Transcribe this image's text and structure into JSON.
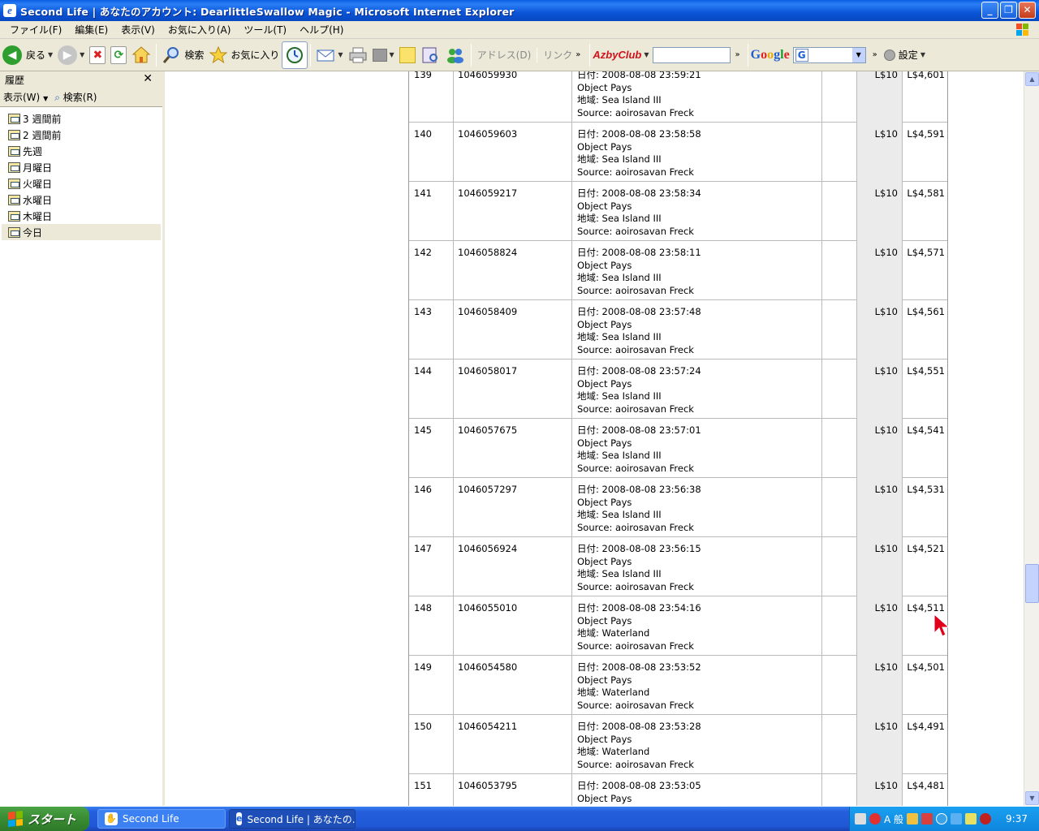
{
  "window": {
    "title": "Second Life | あなたのアカウント: DearlittleSwallow Magic - Microsoft Internet Explorer",
    "minimize": "_",
    "restore": "❐",
    "close": "✕"
  },
  "menu": [
    "ファイル(F)",
    "編集(E)",
    "表示(V)",
    "お気に入り(A)",
    "ツール(T)",
    "ヘルプ(H)"
  ],
  "toolbar": {
    "back_label": "戻る",
    "search_label": "検索",
    "favorites_label": "お気に入り",
    "address_label": "アドレス(D)",
    "links_label": "リンク",
    "azby_label": "AzbyClub",
    "google_label_g": "G",
    "google_label_rest": "oogle",
    "settings_label": "設定"
  },
  "history": {
    "title": "履歴",
    "view_label": "表示(W)",
    "search_label": "検索(R)",
    "items": [
      "3 週間前",
      "2 週間前",
      "先週",
      "月曜日",
      "火曜日",
      "水曜日",
      "木曜日",
      "今日"
    ],
    "selected": "今日"
  },
  "transactions": {
    "date_prefix": "日付: ",
    "region_prefix": "地域: ",
    "source_prefix": "Source: ",
    "rows": [
      {
        "num": "139",
        "id": "1046059930",
        "date": "2008-08-08 23:59:21",
        "type": "Object Pays",
        "region": "Sea Island III",
        "source": "aoirosavan Freck",
        "amount": "L$10",
        "balance": "L$4,601"
      },
      {
        "num": "140",
        "id": "1046059603",
        "date": "2008-08-08 23:58:58",
        "type": "Object Pays",
        "region": "Sea Island III",
        "source": "aoirosavan Freck",
        "amount": "L$10",
        "balance": "L$4,591"
      },
      {
        "num": "141",
        "id": "1046059217",
        "date": "2008-08-08 23:58:34",
        "type": "Object Pays",
        "region": "Sea Island III",
        "source": "aoirosavan Freck",
        "amount": "L$10",
        "balance": "L$4,581"
      },
      {
        "num": "142",
        "id": "1046058824",
        "date": "2008-08-08 23:58:11",
        "type": "Object Pays",
        "region": "Sea Island III",
        "source": "aoirosavan Freck",
        "amount": "L$10",
        "balance": "L$4,571"
      },
      {
        "num": "143",
        "id": "1046058409",
        "date": "2008-08-08 23:57:48",
        "type": "Object Pays",
        "region": "Sea Island III",
        "source": "aoirosavan Freck",
        "amount": "L$10",
        "balance": "L$4,561"
      },
      {
        "num": "144",
        "id": "1046058017",
        "date": "2008-08-08 23:57:24",
        "type": "Object Pays",
        "region": "Sea Island III",
        "source": "aoirosavan Freck",
        "amount": "L$10",
        "balance": "L$4,551"
      },
      {
        "num": "145",
        "id": "1046057675",
        "date": "2008-08-08 23:57:01",
        "type": "Object Pays",
        "region": "Sea Island III",
        "source": "aoirosavan Freck",
        "amount": "L$10",
        "balance": "L$4,541"
      },
      {
        "num": "146",
        "id": "1046057297",
        "date": "2008-08-08 23:56:38",
        "type": "Object Pays",
        "region": "Sea Island III",
        "source": "aoirosavan Freck",
        "amount": "L$10",
        "balance": "L$4,531"
      },
      {
        "num": "147",
        "id": "1046056924",
        "date": "2008-08-08 23:56:15",
        "type": "Object Pays",
        "region": "Sea Island III",
        "source": "aoirosavan Freck",
        "amount": "L$10",
        "balance": "L$4,521"
      },
      {
        "num": "148",
        "id": "1046055010",
        "date": "2008-08-08 23:54:16",
        "type": "Object Pays",
        "region": "Waterland",
        "source": "aoirosavan Freck",
        "amount": "L$10",
        "balance": "L$4,511"
      },
      {
        "num": "149",
        "id": "1046054580",
        "date": "2008-08-08 23:53:52",
        "type": "Object Pays",
        "region": "Waterland",
        "source": "aoirosavan Freck",
        "amount": "L$10",
        "balance": "L$4,501"
      },
      {
        "num": "150",
        "id": "1046054211",
        "date": "2008-08-08 23:53:28",
        "type": "Object Pays",
        "region": "Waterland",
        "source": "aoirosavan Freck",
        "amount": "L$10",
        "balance": "L$4,491"
      },
      {
        "num": "151",
        "id": "1046053795",
        "date": "2008-08-08 23:53:05",
        "type": "Object Pays",
        "region": "",
        "source": "",
        "amount": "L$10",
        "balance": "L$4,481"
      }
    ]
  },
  "taskbar": {
    "start_label": "スタート",
    "tasks": [
      "Second Life",
      "Second Life | あなたの..."
    ],
    "ime_label": "A 般",
    "clock": "9:37"
  },
  "colors": {
    "titlebar": "#0a55d8",
    "taskbar": "#245edb",
    "start": "#3c8f36",
    "chrome": "#ece9d8",
    "amount_column": "#ebebeb",
    "cursor": "#e0001b"
  }
}
